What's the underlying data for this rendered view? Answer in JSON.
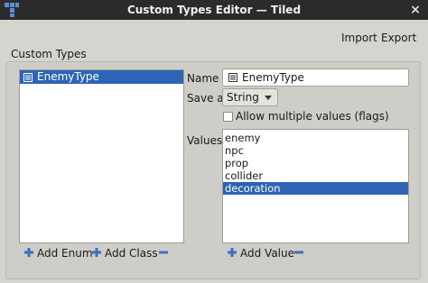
{
  "window": {
    "title": "Custom Types Editor — Tiled",
    "logo_icon": "tiled-logo-icon",
    "close_label": "×"
  },
  "toolbar": {
    "import_label": "Import",
    "export_label": "Export"
  },
  "group": {
    "title": "Custom Types"
  },
  "types": {
    "items": [
      {
        "label": "EnemyType",
        "icon": "enum-icon",
        "selected": true
      }
    ]
  },
  "properties": {
    "name_label": "Name",
    "name_value": "EnemyType",
    "save_as_label": "Save as",
    "save_as_value": "String",
    "allow_multiple_label": "Allow multiple values (flags)",
    "allow_multiple_checked": false,
    "values_label": "Values",
    "values": [
      {
        "label": "enemy",
        "selected": false
      },
      {
        "label": "npc",
        "selected": false
      },
      {
        "label": "prop",
        "selected": false
      },
      {
        "label": "collider",
        "selected": false
      },
      {
        "label": "decoration",
        "selected": true
      }
    ]
  },
  "buttons": {
    "add_enum": "Add Enum",
    "add_class": "Add Class",
    "add_value": "Add Value"
  },
  "colors": {
    "selection": "#2d64b5",
    "accent_plus": "#3a6fc4"
  }
}
